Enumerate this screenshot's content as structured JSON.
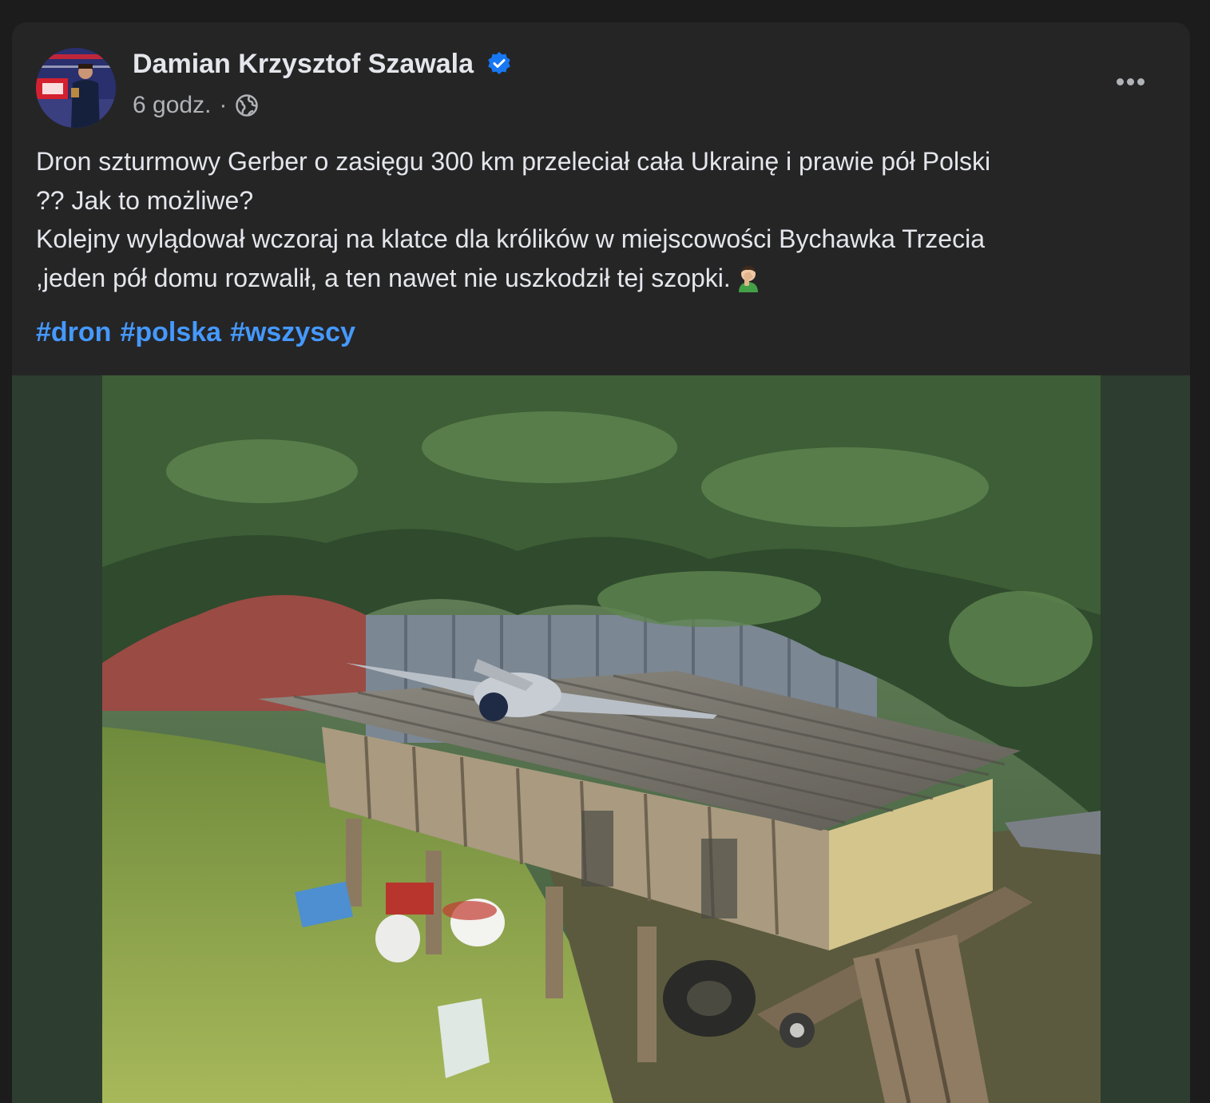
{
  "post": {
    "author": "Damian Krzysztof Szawala",
    "verified_icon": "verified-badge-icon",
    "time": "6 godz.",
    "separator": "·",
    "audience_icon": "globe-icon",
    "more_icon": "more-options-icon",
    "text_lines": [
      "Dron szturmowy Gerber o zasięgu 300 km przeleciał cała Ukrainę i prawie pół Polski",
      "?? Jak to możliwe?",
      "Kolejny wylądował wczoraj na klatce dla królików w miejscowości Bychawka Trzecia",
      ",jeden pół domu rozwalił, a ten nawet nie uszkodził tej szopki."
    ],
    "emoji_icon": "facepalm-emoji-icon",
    "hashtags": [
      "#dron",
      "#polska",
      "#wszyscy"
    ]
  },
  "colors": {
    "background": "#1c1c1d",
    "card": "#252526",
    "text_primary": "#e4e6eb",
    "text_secondary": "#b0b3b8",
    "hashtag": "#4599ff",
    "verified": "#1877f2",
    "media_letterbox": "#2d3d2f"
  }
}
